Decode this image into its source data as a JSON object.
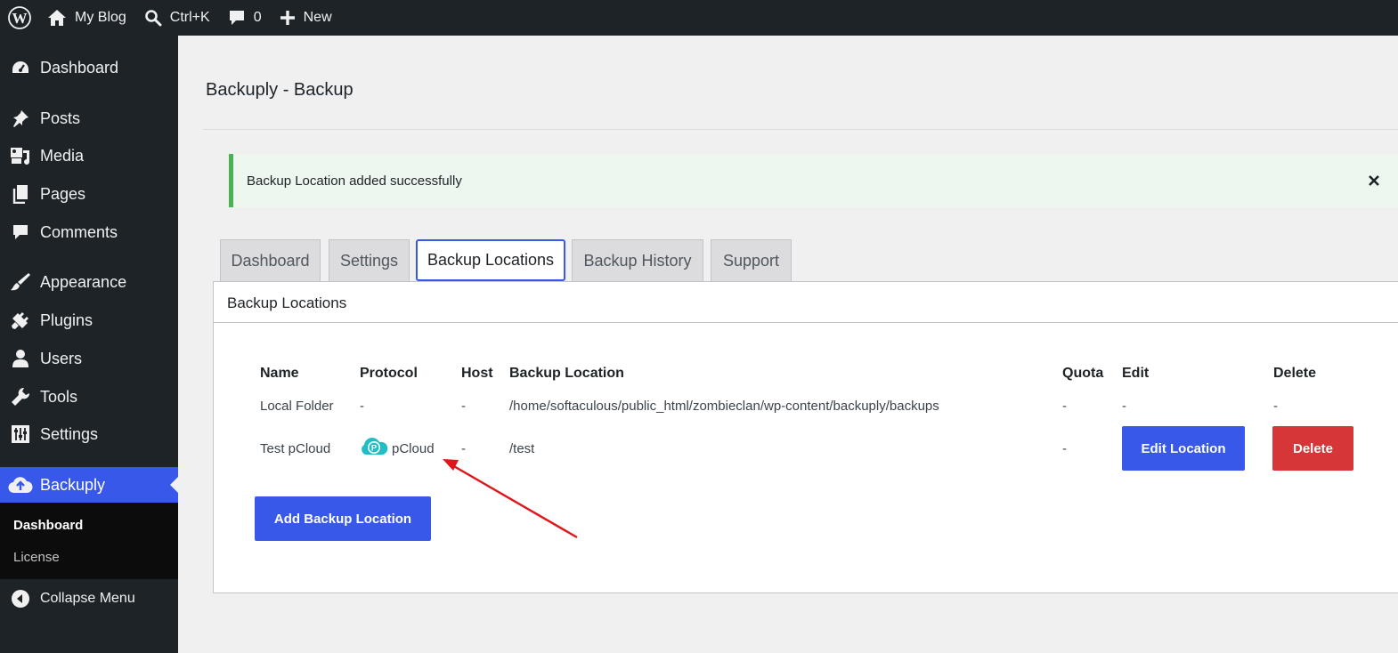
{
  "adminbar": {
    "site_name": "My Blog",
    "search_shortcut": "Ctrl+K",
    "comments_count": "0",
    "new_label": "New"
  },
  "sidebar": {
    "items": [
      {
        "label": "Dashboard",
        "icon": "dashboard-icon"
      },
      {
        "label": "Posts",
        "icon": "pushpin-icon"
      },
      {
        "label": "Media",
        "icon": "media-icon"
      },
      {
        "label": "Pages",
        "icon": "pages-icon"
      },
      {
        "label": "Comments",
        "icon": "comment-icon"
      },
      {
        "label": "Appearance",
        "icon": "brush-icon"
      },
      {
        "label": "Plugins",
        "icon": "plug-icon"
      },
      {
        "label": "Users",
        "icon": "user-icon"
      },
      {
        "label": "Tools",
        "icon": "wrench-icon"
      },
      {
        "label": "Settings",
        "icon": "sliders-icon"
      },
      {
        "label": "Backuply",
        "icon": "cloud-upload-icon"
      }
    ],
    "submenu": [
      "Dashboard",
      "License"
    ],
    "collapse_label": "Collapse Menu"
  },
  "page": {
    "title": "Backuply - Backup",
    "notice": "Backup Location added successfully"
  },
  "tabs": [
    "Dashboard",
    "Settings",
    "Backup Locations",
    "Backup History",
    "Support"
  ],
  "active_tab": "Backup Locations",
  "panel": {
    "title": "Backup Locations",
    "columns": [
      "Name",
      "Protocol",
      "Host",
      "Backup Location",
      "Quota",
      "Edit",
      "Delete"
    ],
    "rows": [
      {
        "name": "Local Folder",
        "protocol": "-",
        "host": "-",
        "location": "/home/softaculous/public_html/zombieclan/wp-content/backuply/backups",
        "quota": "-",
        "edit": "-",
        "delete": "-"
      },
      {
        "name": "Test pCloud",
        "protocol": "pCloud",
        "host": "-",
        "location": "/test",
        "quota": "-",
        "edit": "Edit Location",
        "delete": "Delete"
      }
    ],
    "add_button": "Add Backup Location"
  },
  "colors": {
    "accent": "#3858e9",
    "danger": "#d63638",
    "success": "#46b450",
    "annotation_arrow": "#e0161b",
    "pcloud": "#20bdc5"
  }
}
